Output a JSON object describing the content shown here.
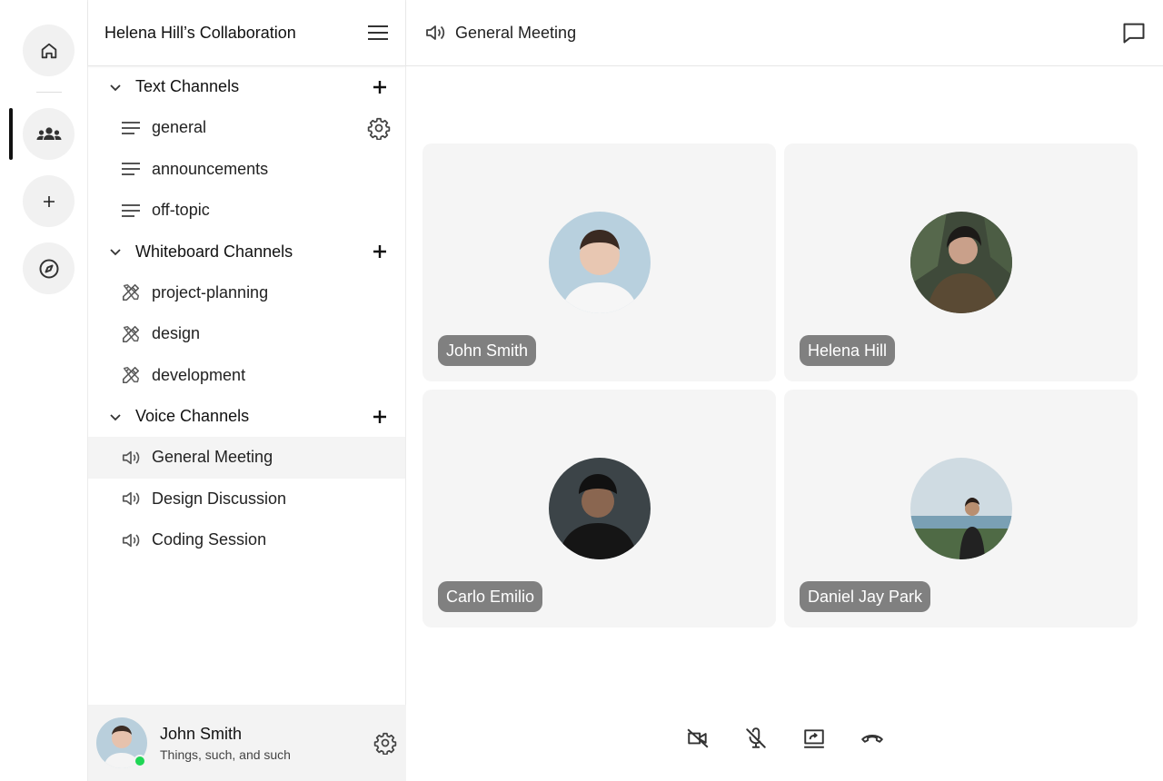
{
  "server": {
    "title": "Helena Hill’s Collaboration"
  },
  "groups": [
    {
      "title": "Text Channels",
      "channels": [
        {
          "label": "general"
        },
        {
          "label": "announcements"
        },
        {
          "label": "off-topic"
        }
      ]
    },
    {
      "title": "Whiteboard Channels",
      "channels": [
        {
          "label": "project-planning"
        },
        {
          "label": "design"
        },
        {
          "label": "development"
        }
      ]
    },
    {
      "title": "Voice Channels",
      "channels": [
        {
          "label": "General Meeting",
          "active": true
        },
        {
          "label": "Design Discussion"
        },
        {
          "label": "Coding Session"
        }
      ]
    }
  ],
  "user": {
    "name": "John Smith",
    "status": "Things, such, and such",
    "online_color": "#1fd655"
  },
  "main": {
    "channel_title": "General Meeting",
    "participants": [
      {
        "name": "John Smith"
      },
      {
        "name": "Helena Hill"
      },
      {
        "name": "Carlo Emilio"
      },
      {
        "name": "Daniel Jay Park"
      }
    ]
  },
  "rail": {
    "items": [
      "home-icon",
      "group-icon",
      "plus-icon",
      "compass-icon"
    ]
  }
}
